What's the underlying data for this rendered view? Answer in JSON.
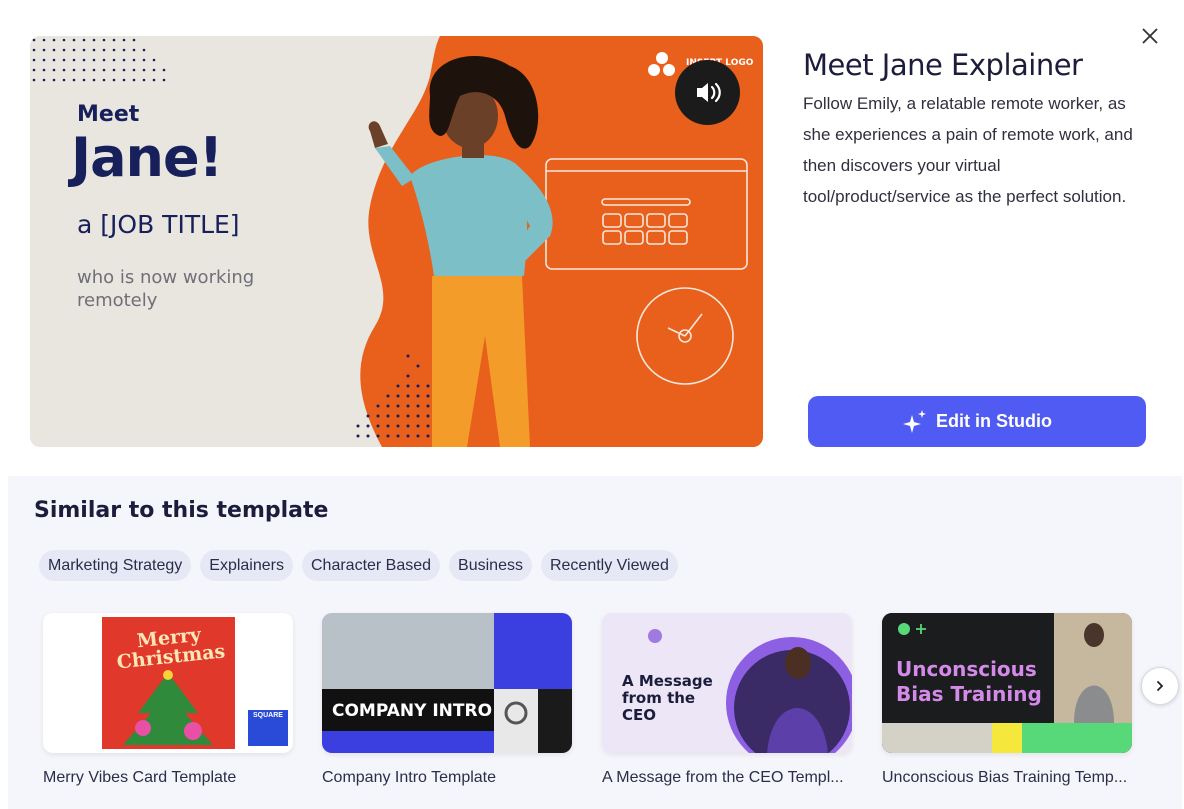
{
  "modal": {
    "close_icon": "close-icon"
  },
  "preview": {
    "line_meet": "Meet",
    "line_name": "Jane!",
    "line_job": "a [JOB TITLE]",
    "line_sub": "who is now working remotely",
    "logo_text": "INSERT LOGO",
    "sound_icon": "speaker-icon",
    "colors": {
      "background": "#e9e5df",
      "accent": "#e8601c",
      "navy": "#17205a"
    }
  },
  "details": {
    "title": "Meet Jane Explainer",
    "description": "Follow Emily, a relatable remote worker, as she experiences a pain of remote work, and then discovers your virtual tool/product/service as the perfect solution.",
    "edit_button": "Edit in Studio",
    "edit_icon": "sparkle-icon",
    "button_color": "#4f5bf2"
  },
  "similar": {
    "heading": "Similar to this template",
    "tags": [
      "Marketing Strategy",
      "Explainers",
      "Character Based",
      "Business",
      "Recently Viewed"
    ],
    "cards": [
      {
        "label": "Merry Vibes Card Template",
        "thumb_text": "Merry Christmas",
        "badge": "SQUARE"
      },
      {
        "label": "Company Intro Template",
        "thumb_text": "COMPANY INTRO"
      },
      {
        "label": "A Message from the CEO Templ...",
        "thumb_text": "A Message from the CEO"
      },
      {
        "label": "Unconscious Bias Training Temp...",
        "thumb_text": "Unconscious Bias Training"
      }
    ],
    "next_icon": "chevron-right-icon"
  }
}
